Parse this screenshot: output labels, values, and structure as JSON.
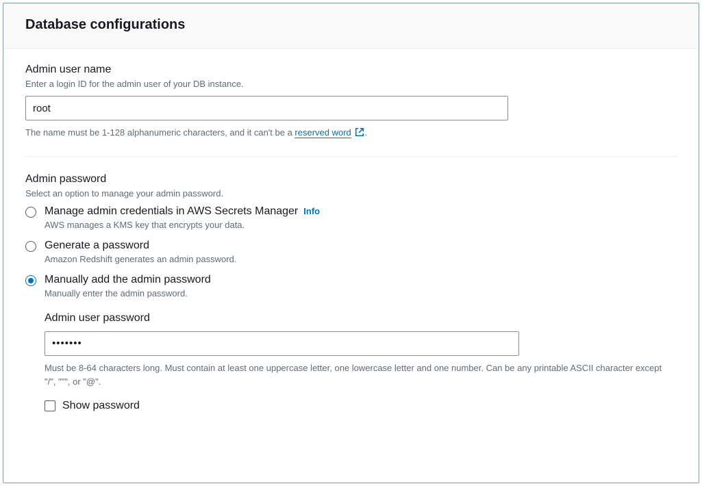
{
  "header": {
    "title": "Database configurations"
  },
  "adminUser": {
    "label": "Admin user name",
    "description": "Enter a login ID for the admin user of your DB instance.",
    "value": "root",
    "constraintPre": "The name must be 1-128 alphanumeric characters, and it can't be a ",
    "constraintLink": "reserved word",
    "constraintPost": "."
  },
  "adminPassword": {
    "label": "Admin password",
    "description": "Select an option to manage your admin password.",
    "infoLabel": "Info",
    "options": [
      {
        "title": "Manage admin credentials in AWS Secrets Manager",
        "desc": "AWS manages a KMS key that encrypts your data."
      },
      {
        "title": "Generate a password",
        "desc": "Amazon Redshift generates an admin password."
      },
      {
        "title": "Manually add the admin password",
        "desc": "Manually enter the admin password."
      }
    ],
    "selectedIndex": 2,
    "manual": {
      "label": "Admin user password",
      "value": "•••••••",
      "constraint": "Must be 8-64 characters long. Must contain at least one uppercase letter, one lowercase letter and one number. Can be any printable ASCII character except \"/\", \"\"\", or \"@\".",
      "showPasswordLabel": "Show password",
      "showPasswordChecked": false
    }
  }
}
